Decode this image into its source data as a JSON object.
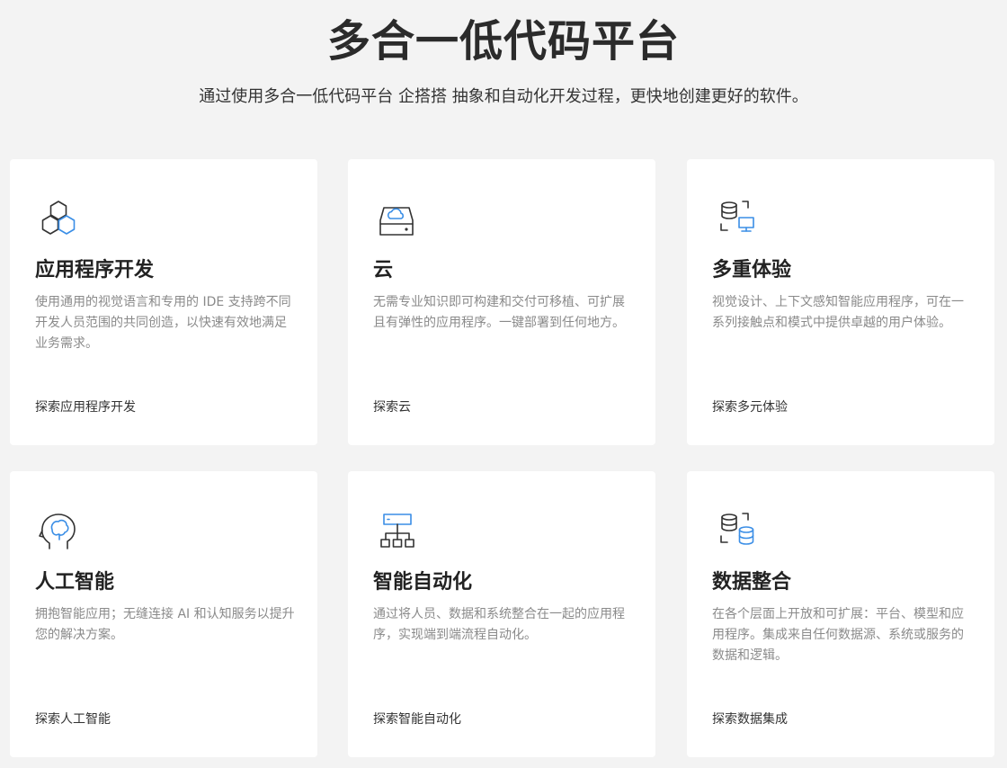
{
  "header": {
    "title": "多合一低代码平台",
    "subtitle": "通过使用多合一低代码平台 企搭搭 抽象和自动化开发过程，更快地创建更好的软件。"
  },
  "colors": {
    "background": "#f3f3f3",
    "card": "#ffffff",
    "icon_dark": "#333333",
    "icon_accent": "#3a8ee6"
  },
  "cards": [
    {
      "icon": "hexagons-icon",
      "title": "应用程序开发",
      "description": "使用通用的视觉语言和专用的 IDE 支持跨不同开发人员范围的共同创造，以快速有效地满足业务需求。",
      "link": "探索应用程序开发"
    },
    {
      "icon": "cloud-drive-icon",
      "title": "云",
      "description": "无需专业知识即可构建和交付可移植、可扩展且有弹性的应用程序。一键部署到任何地方。",
      "link": "探索云"
    },
    {
      "icon": "database-monitor-icon",
      "title": "多重体验",
      "description": "视觉设计、上下文感知智能应用程序，可在一系列接触点和模式中提供卓越的用户体验。",
      "link": "探索多元体验"
    },
    {
      "icon": "brain-head-icon",
      "title": "人工智能",
      "description": "拥抱智能应用；无缝连接 AI 和认知服务以提升您的解决方案。",
      "link": "探索人工智能"
    },
    {
      "icon": "org-chart-icon",
      "title": "智能自动化",
      "description": "通过将人员、数据和系统整合在一起的应用程序，实现端到端流程自动化。",
      "link": "探索智能自动化"
    },
    {
      "icon": "database-merge-icon",
      "title": "数据整合",
      "description": "在各个层面上开放和可扩展：平台、模型和应用程序。集成来自任何数据源、系统或服务的数据和逻辑。",
      "link": "探索数据集成"
    }
  ]
}
